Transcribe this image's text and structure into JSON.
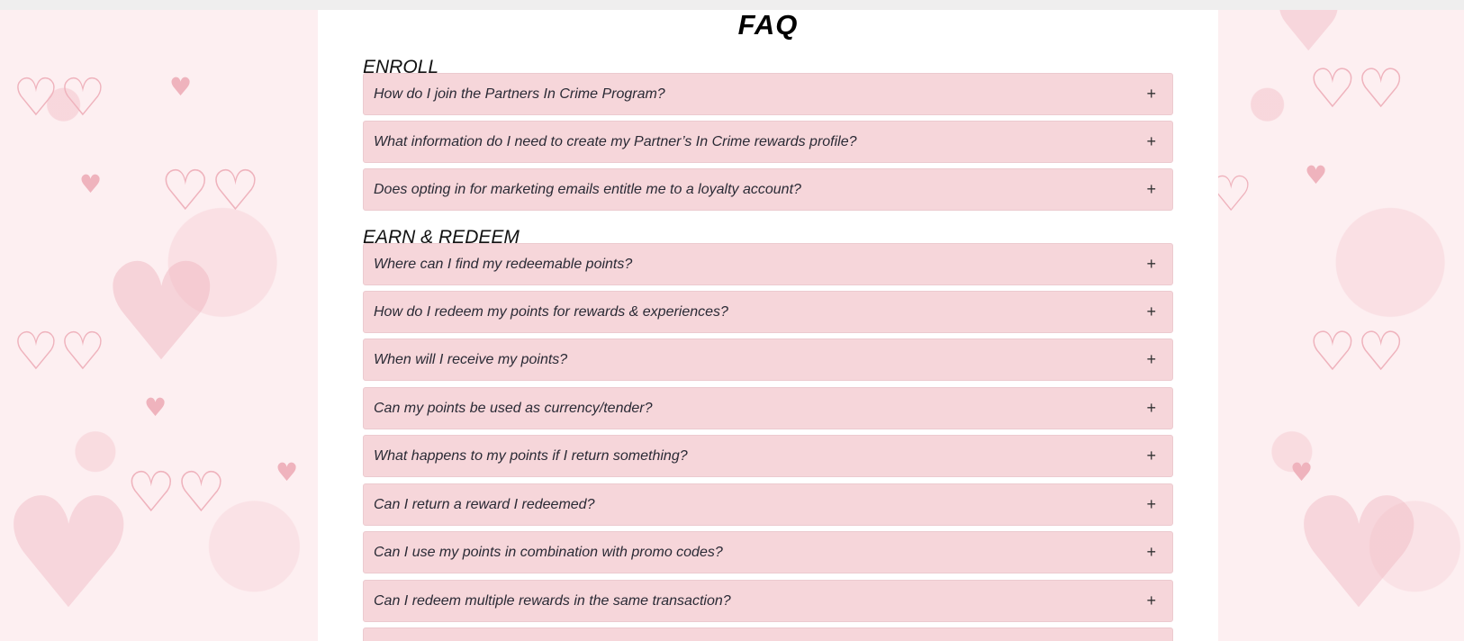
{
  "page": {
    "title": "FAQ"
  },
  "sections": [
    {
      "title": "ENROLL",
      "items": [
        {
          "question": "How do I join the Partners In Crime Program?",
          "toggle": "+"
        },
        {
          "question": "What information do I need to create my Partner’s In Crime rewards profile?",
          "toggle": "+"
        },
        {
          "question": "Does opting in for marketing emails entitle me to a loyalty account?",
          "toggle": "+"
        }
      ]
    },
    {
      "title": "EARN & REDEEM",
      "items": [
        {
          "question": "Where can I find my redeemable points?",
          "toggle": "+"
        },
        {
          "question": "How do I redeem my points for rewards & experiences?",
          "toggle": "+"
        },
        {
          "question": "When will I receive my points?",
          "toggle": "+"
        },
        {
          "question": "Can my points be used as currency/tender?",
          "toggle": "+"
        },
        {
          "question": "What happens to my points if I return something?",
          "toggle": "+"
        },
        {
          "question": "Can I return a reward I redeemed?",
          "toggle": "+"
        },
        {
          "question": "Can I use my points in combination with promo codes?",
          "toggle": "+"
        },
        {
          "question": "Can I redeem multiple rewards in the same transaction?",
          "toggle": "+"
        }
      ]
    }
  ],
  "decor": {
    "heart_icon": "heart-icon",
    "handcuff_icon": "handcuff-icon"
  },
  "colors": {
    "item_bg": "#f6d6da",
    "panel_bg": "#ffffff",
    "pattern_pink": "#efb3bd"
  }
}
